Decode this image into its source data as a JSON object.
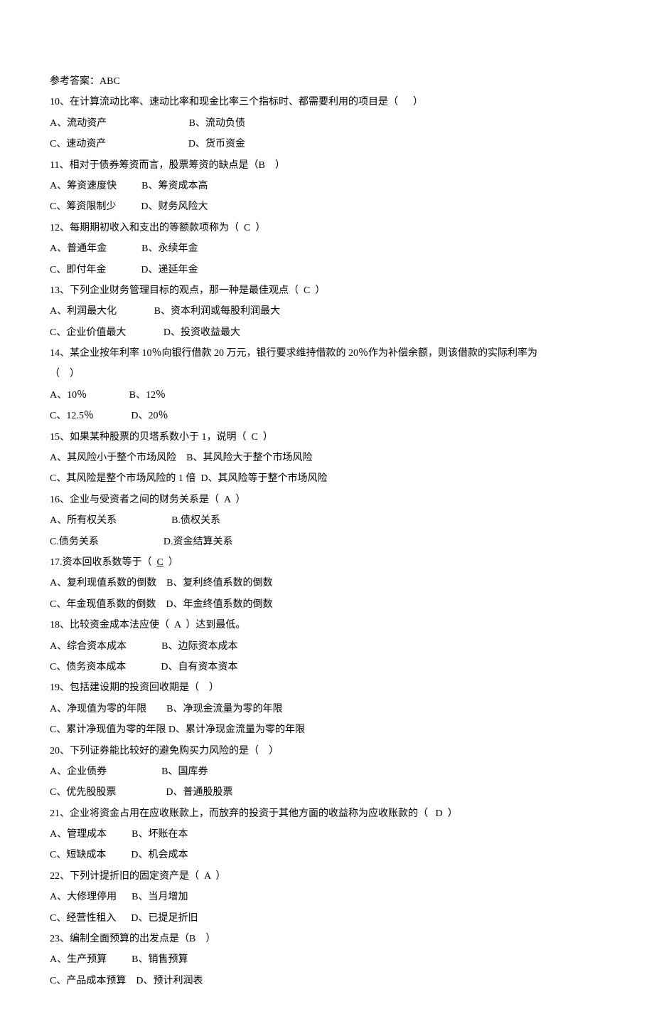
{
  "ref_answer": "参考答案：ABC",
  "q10": {
    "stem": "10、在计算流动比率、速动比率和现金比率三个指标时、都需要利用的项目是（      ）",
    "a": "A、流动资产",
    "b": "B、流动负债",
    "c": "C、速动资产",
    "d": "D、货币资金"
  },
  "q11": {
    "stem": "11、相对于债券筹资而言，股票筹资的缺点是（B    ）",
    "a": "A、筹资速度快",
    "b": "B、筹资成本高",
    "c": "C、筹资限制少",
    "d": "D、财务风险大"
  },
  "q12": {
    "stem": "12、每期期初收入和支出的等额款项称为（  C  ）",
    "a": "A、普通年金",
    "b": "B、永续年金",
    "c": "C、即付年金",
    "d": "D、递延年金"
  },
  "q13": {
    "stem": "13、下列企业财务管理目标的观点，那一种是最佳观点（  C  ）",
    "a": "A、利润最大化",
    "b": "B、资本利润或每股利润最大",
    "c": "C、企业价值最大",
    "d": "D、投资收益最大"
  },
  "q14": {
    "stem1": "14、某企业按年利率 10％向银行借款 20 万元，银行要求维持借款的 20％作为补偿余额，则该借款的实际利率为",
    "stem2": "（    ）",
    "a": "A、10％",
    "b": "B、12％",
    "c": "C、12.5％",
    "d": "D、20％"
  },
  "q15": {
    "stem": "15、如果某种股票的贝塔系数小于 1，说明（  C  ）",
    "a": "A、其风险小于整个市场风险",
    "b": "B、其风险大于整个市场风险",
    "c": "C、其风险是整个市场风险的 1 倍",
    "d": "D、其风险等于整个市场风险"
  },
  "q16": {
    "stem": "16、企业与受资者之间的财务关系是（  A  ）",
    "a": "A、所有权关系",
    "b": "B.债权关系",
    "c": "C.债务关系",
    "d": "D.资金结算关系"
  },
  "q17": {
    "stem_pre": "17.资本回收系数等于（  ",
    "stem_ans": "C",
    "stem_post": "  ）",
    "a": "A、复利现值系数的倒数",
    "b": "B、复利终值系数的倒数",
    "c": "C、年金现值系数的倒数",
    "d": "D、年金终值系数的倒数"
  },
  "q18": {
    "stem": "18、比较资金成本法应使（  A  ）达到最低。",
    "a": "A、综合资本成本",
    "b": "B、边际资本成本",
    "c": "C、债务资本成本",
    "d": "D、自有资本资本"
  },
  "q19": {
    "stem": "19、包括建设期的投资回收期是（    ）",
    "a": "A、净现值为零的年限",
    "b": "B、净现金流量为零的年限",
    "c": "C、累计净现值为零的年限",
    "d": "D、累计净现金流量为零的年限"
  },
  "q20": {
    "stem": "20、下列证券能比较好的避免购买力风险的是（    ）",
    "a": "A、企业债券",
    "b": "B、国库券",
    "c": "C、优先股股票",
    "d": "D、普通股股票"
  },
  "q21": {
    "stem": "21、企业将资金占用在应收账款上，而放弃的投资于其他方面的收益称为应收账款的（   D  ）",
    "a": "A、管理成本",
    "b": "B、坏账在本",
    "c": "C、短缺成本",
    "d": "D、机会成本"
  },
  "q22": {
    "stem": "22、下列计提折旧的固定资产是（  A  ）",
    "a": "A、大修理停用",
    "b": "B、当月增加",
    "c": "C、经营性租入",
    "d": "D、已提足折旧"
  },
  "q23": {
    "stem": "23、编制全面预算的出发点是（B    ）",
    "a": "A、生产预算",
    "b": "B、销售预算",
    "c": "C、产品成本预算",
    "d": "D、预计利润表"
  }
}
